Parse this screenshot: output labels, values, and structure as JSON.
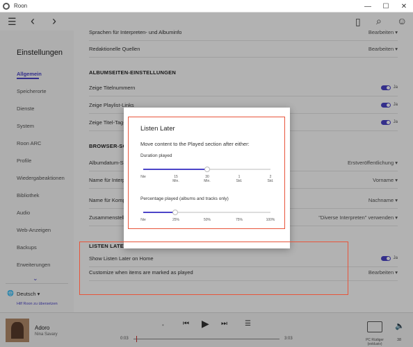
{
  "window": {
    "title": "Roon",
    "minimize": "—",
    "maximize": "☐",
    "close": "✕"
  },
  "topnav": {
    "menu_icon": "☰",
    "back_icon": "‹",
    "forward_icon": "›",
    "bookmark_icon": "▯",
    "search_icon": "⌕",
    "avatar_icon": "☺"
  },
  "sidebar": {
    "heading": "Einstellungen",
    "items": [
      {
        "label": "Allgemein"
      },
      {
        "label": "Speicherorte"
      },
      {
        "label": "Dienste"
      },
      {
        "label": "System"
      },
      {
        "label": "Roon ARC"
      },
      {
        "label": "Profile"
      },
      {
        "label": "Wiedergabeaktionen"
      },
      {
        "label": "Bibliothek"
      },
      {
        "label": "Audio"
      },
      {
        "label": "Web-Anzeigen"
      },
      {
        "label": "Backups"
      },
      {
        "label": "Erweiterungen"
      }
    ],
    "scroll_icon": "⌄",
    "language": "Deutsch ▾",
    "language_icon": "🌐",
    "translate_link": "Hilf Roon zu übersetzen"
  },
  "main": {
    "row_top": {
      "label": "Sprachen für Interpreten- und Albuminfo",
      "value": "Bearbeiten ▾"
    },
    "row_editorial": {
      "label": "Redaktionelle Quellen",
      "value": "Bearbeiten ▾"
    },
    "section_album": "ALBUMSEITEN-EINSTELLUNGEN",
    "row_titelnummern": {
      "label": "Zeige Titelnummern",
      "value": "Ja"
    },
    "row_playlist": {
      "label": "Zeige Playlist-Links",
      "value": "Ja"
    },
    "row_titeltag": {
      "label": "Zeige Titel-Tag-Links",
      "value": "Ja"
    },
    "section_browser": "BROWSER-SORTIERUNG",
    "row_albumdatum": {
      "label": "Albumdatum-Sortierung",
      "value": "Erstveröffentlichung ▾"
    },
    "row_interpret": {
      "label": "Name für Interpreten",
      "value": "Vorname ▾"
    },
    "row_komponist": {
      "label": "Name für Komponisten",
      "value": "Nachname ▾"
    },
    "row_zusammen": {
      "label": "Zusammenstellungen",
      "value": "\"Diverse Interpreten\" verwenden ▾"
    },
    "section_listen": "LISTEN LATER",
    "row_show_listen": {
      "label": "Show Listen Later on Home",
      "value": "Ja"
    },
    "row_customize": {
      "label": "Customize when items are marked as played",
      "value": "Bearbeiten ▾"
    }
  },
  "modal": {
    "title": "Listen Later",
    "description": "Move content to the Played section after either:",
    "duration_label": "Duration played",
    "duration_ticks": [
      "Nie",
      "15\nMin.",
      "30\nMin.",
      "1\nStd.",
      "2\nStd."
    ],
    "duration_value_fraction": 0.5,
    "percentage_label": "Percentage played (albums and tracks only)",
    "percentage_ticks": [
      "Nie",
      "25%",
      "50%",
      "75%",
      "100%"
    ],
    "percentage_value_fraction": 0.25
  },
  "player": {
    "song": "Adoro",
    "artist": "Nina Savary",
    "shuffle_icon": "•",
    "prev_icon": "⏮",
    "play_icon": "▶",
    "next_icon": "⏭",
    "queue_icon": "☰",
    "elapsed": "0:03",
    "total": "3:03",
    "zone": "PC Rüdiger\n(exklusiv)",
    "volume_icon": "🔈",
    "volume": "38"
  },
  "colors": {
    "accent": "#4b44c8",
    "annotation_red": "#e8543a"
  }
}
